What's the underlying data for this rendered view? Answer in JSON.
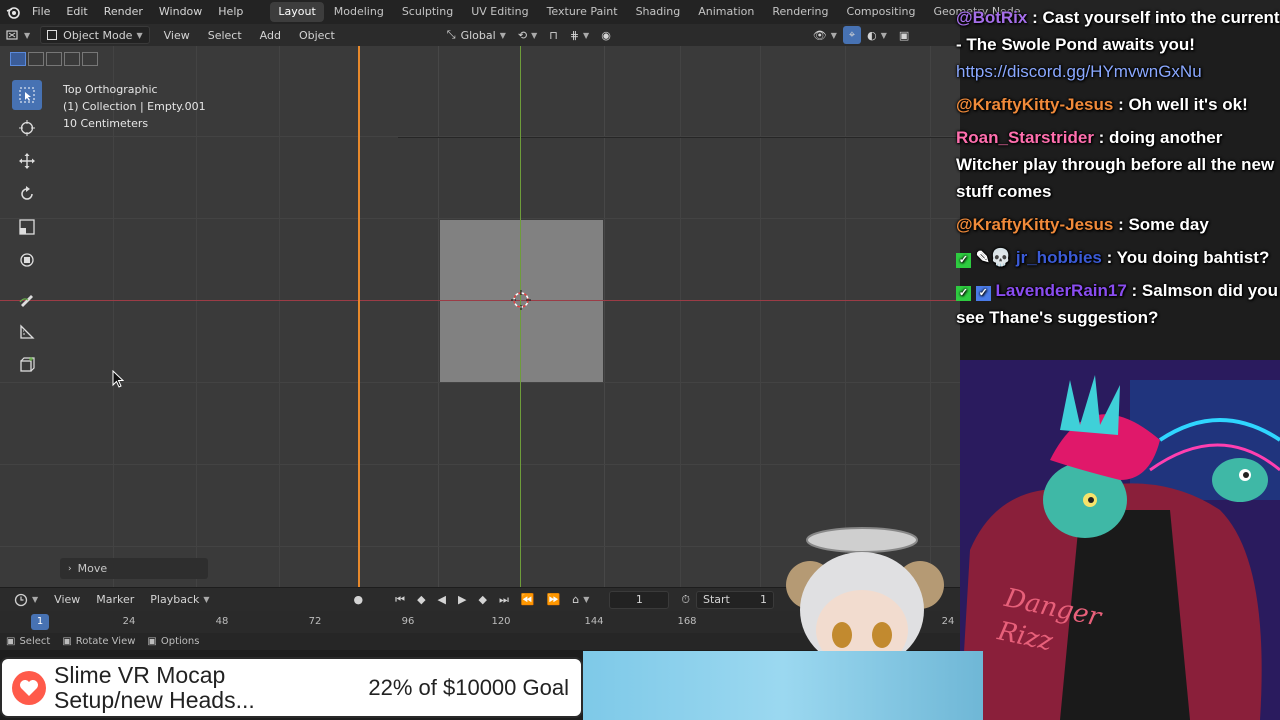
{
  "menubar": {
    "menus": [
      "File",
      "Edit",
      "Render",
      "Window",
      "Help"
    ],
    "workspaces": [
      "Layout",
      "Modeling",
      "Sculpting",
      "UV Editing",
      "Texture Paint",
      "Shading",
      "Animation",
      "Rendering",
      "Compositing",
      "Geometry Node"
    ],
    "active_workspace": "Layout"
  },
  "header": {
    "mode": "Object Mode",
    "menus": [
      "View",
      "Select",
      "Add",
      "Object"
    ],
    "orientation": "Global"
  },
  "viewport": {
    "view_name": "Top Orthographic",
    "collection": "(1) Collection | Empty.001",
    "scale": "10 Centimeters",
    "last_operator": "Move"
  },
  "timeline": {
    "menus": [
      "View",
      "Marker",
      "Playback"
    ],
    "current_frame": "1",
    "start_label": "Start",
    "start_value": "1",
    "ruler_labels": [
      "1",
      "24",
      "48",
      "72",
      "96",
      "120",
      "144",
      "168",
      "24"
    ]
  },
  "status_bar": {
    "items": [
      "Select",
      "Rotate View",
      "Options"
    ]
  },
  "chat": [
    {
      "user": "@BotRix",
      "message": ": Cast yourself into the current - The Swole Pond awaits you!",
      "link": "https://discord.gg/HYmvwnGxNu",
      "color": "#a46ee8"
    },
    {
      "user": "@KraftyKitty-Jesus",
      "message": ": Oh well it's ok!",
      "color": "#f08a3a"
    },
    {
      "user": "Roan_Starstrider",
      "message": ": doing another Witcher play through before all the new stuff comes",
      "color": "#ff6fae"
    },
    {
      "user": "@KraftyKitty-Jesus",
      "message": ": Some day",
      "color": "#f08a3a"
    },
    {
      "user": "jr_hobbies",
      "message": ": You doing bahtist?",
      "color": "#3b5bd6"
    },
    {
      "user": "LavenderRain17",
      "message": ": Salmson did you see Thane's suggestion?",
      "color": "#8a4df0"
    }
  ],
  "goal": {
    "title_line1": "Slime VR Mocap",
    "title_line2": "Setup/new Heads...",
    "progress": "22% of $10000 Goal",
    "progress_fraction": 0.22
  },
  "avatar": {
    "shirt_text": "Danger Rizz"
  },
  "colors": {
    "viewport_bg": "#3a3a3a",
    "x_axis": "#9b3c46",
    "y_axis": "#6e9c3a",
    "frame_line": "#e8892b",
    "accent": "#4772b3"
  }
}
